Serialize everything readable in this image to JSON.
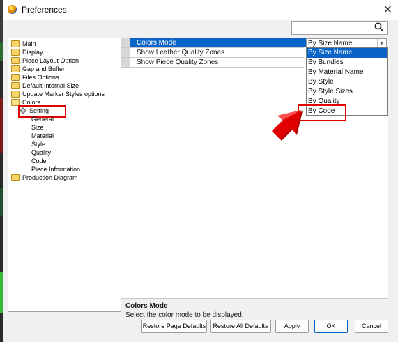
{
  "window": {
    "title": "Preferences"
  },
  "search": {
    "placeholder": ""
  },
  "tree": {
    "items": [
      {
        "label": "Main",
        "icon": "folder-icon"
      },
      {
        "label": "Display",
        "icon": "folder-icon"
      },
      {
        "label": "Piece Layout Option",
        "icon": "folder-icon"
      },
      {
        "label": "Gap and Buffer",
        "icon": "folder-icon"
      },
      {
        "label": "Files Options",
        "icon": "folder-icon"
      },
      {
        "label": "Default Internal Size",
        "icon": "folder-icon"
      },
      {
        "label": "Update Marker Styles options",
        "icon": "folder-icon"
      },
      {
        "label": "Colors",
        "icon": "open-folder-icon"
      },
      {
        "label": "Setting",
        "icon": "diamond-icon"
      },
      {
        "label": "General"
      },
      {
        "label": "Size"
      },
      {
        "label": "Material"
      },
      {
        "label": "Style"
      },
      {
        "label": "Quality"
      },
      {
        "label": "Code"
      },
      {
        "label": "Piece Information"
      },
      {
        "label": "Production Diagram",
        "icon": "folder-icon"
      }
    ]
  },
  "grid": {
    "rows": [
      {
        "name": "Colors Mode",
        "value": "By Size Name"
      },
      {
        "name": "Show Leather Quality Zones"
      },
      {
        "name": "Show Piece Quality Zones"
      }
    ]
  },
  "dropdown": {
    "options": [
      "By Size Name",
      "By Bundles",
      "By Material Name",
      "By Style",
      "By Style Sizes",
      "By Quality",
      "By Code"
    ],
    "selected": "By Size Name"
  },
  "description": {
    "title": "Colors Mode",
    "text": "Select the color mode to be displayed."
  },
  "buttons": {
    "restore_page": "Restore Page Defaults",
    "restore_all": "Restore All Defaults",
    "apply": "Apply",
    "ok": "OK",
    "cancel": "Cancel"
  },
  "colors": {
    "selection": "#0a64c8",
    "highlight_box": "#e00000",
    "pointer_arrow": "#e00000"
  }
}
